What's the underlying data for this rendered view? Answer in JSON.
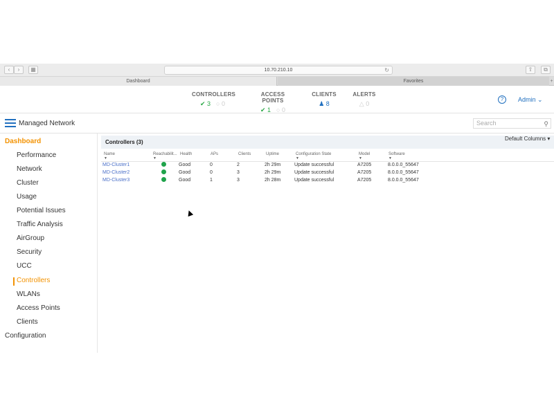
{
  "browser": {
    "url": "10.70.210.10",
    "tabs": [
      {
        "label": "Dashboard"
      },
      {
        "label": "Favorites"
      }
    ]
  },
  "status": {
    "controllers": {
      "label": "CONTROLLERS",
      "ok": "3",
      "other": "0"
    },
    "access_points": {
      "label": "ACCESS POINTS",
      "ok": "1",
      "other": "0"
    },
    "clients": {
      "label": "CLIENTS",
      "value": "8"
    },
    "alerts": {
      "label": "ALERTS",
      "value": "0"
    }
  },
  "header": {
    "user": "Admin",
    "app_title": "Managed Network",
    "search_placeholder": "Search"
  },
  "sidebar": {
    "dashboard": "Dashboard",
    "items": [
      {
        "label": "Performance"
      },
      {
        "label": "Network"
      },
      {
        "label": "Cluster"
      },
      {
        "label": "Usage"
      },
      {
        "label": "Potential Issues"
      },
      {
        "label": "Traffic Analysis"
      },
      {
        "label": "AirGroup"
      },
      {
        "label": "Security"
      },
      {
        "label": "UCC"
      },
      {
        "label": "Controllers"
      },
      {
        "label": "WLANs"
      },
      {
        "label": "Access Points"
      },
      {
        "label": "Clients"
      }
    ],
    "configuration": "Configuration"
  },
  "panel": {
    "title": "Controllers (3)",
    "default_columns": "Default Columns"
  },
  "table": {
    "columns": [
      "Name",
      "Reachabilit...",
      "Health",
      "APs",
      "Clients",
      "Uptime",
      "Configuration State",
      "Model",
      "Software"
    ],
    "rows": [
      {
        "name": "MD-Cluster1",
        "health": "Good",
        "aps": "0",
        "clients": "2",
        "uptime": "2h 29m",
        "state": "Update successful",
        "model": "A7205",
        "software": "8.0.0.0_55647"
      },
      {
        "name": "MD-Cluster2",
        "health": "Good",
        "aps": "0",
        "clients": "3",
        "uptime": "2h 29m",
        "state": "Update successful",
        "model": "A7205",
        "software": "8.0.0.0_55647"
      },
      {
        "name": "MD-Cluster3",
        "health": "Good",
        "aps": "1",
        "clients": "3",
        "uptime": "2h 28m",
        "state": "Update successful",
        "model": "A7205",
        "software": "8.0.0.0_55647"
      }
    ]
  },
  "colors": {
    "accent": "#f39200",
    "ok": "#28a745",
    "link": "#4a6fc8",
    "primary": "#1f6fbf"
  }
}
